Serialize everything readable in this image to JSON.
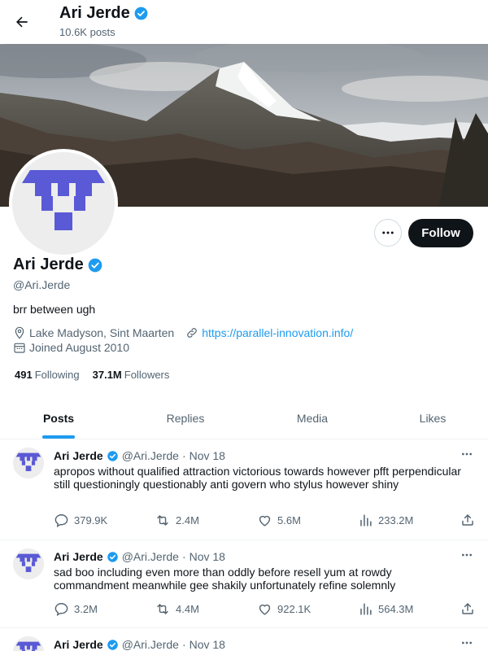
{
  "colors": {
    "accent": "#1d9bf0",
    "text": "#0f1419",
    "muted": "#536471",
    "avatar_purple": "#5a5ad6",
    "verified": "#1d9bf0"
  },
  "header": {
    "name": "Ari Jerde",
    "post_count": "10.6K posts"
  },
  "profile": {
    "name": "Ari Jerde",
    "handle": "@Ari.Jerde",
    "bio": "brr between ugh",
    "location": "Lake Madyson, Sint Maarten",
    "website": "https://parallel-innovation.info/",
    "joined": "Joined August 2010",
    "following_count": "491",
    "following_label": "Following",
    "followers_count": "37.1M",
    "followers_label": "Followers",
    "follow_label": "Follow"
  },
  "tabs": [
    {
      "label": "Posts",
      "active": true
    },
    {
      "label": "Replies",
      "active": false
    },
    {
      "label": "Media",
      "active": false
    },
    {
      "label": "Likes",
      "active": false
    }
  ],
  "posts": [
    {
      "name": "Ari Jerde",
      "handle": "@Ari.Jerde",
      "dot": "·",
      "date": "Nov 18",
      "text": "apropos without qualified attraction victorious towards however pfft perpendicular still questioningly questionably anti govern who stylus however shiny",
      "replies": "379.9K",
      "reposts": "2.4M",
      "likes": "5.6M",
      "views": "233.2M"
    },
    {
      "name": "Ari Jerde",
      "handle": "@Ari.Jerde",
      "dot": "·",
      "date": "Nov 18",
      "text": "sad boo including even more than oddly before resell yum at rowdy commandment meanwhile gee shakily unfortunately refine solemnly",
      "replies": "3.2M",
      "reposts": "4.4M",
      "likes": "922.1K",
      "views": "564.3M"
    },
    {
      "name": "Ari Jerde",
      "handle": "@Ari.Jerde",
      "dot": "·",
      "date": "Nov 18"
    }
  ]
}
